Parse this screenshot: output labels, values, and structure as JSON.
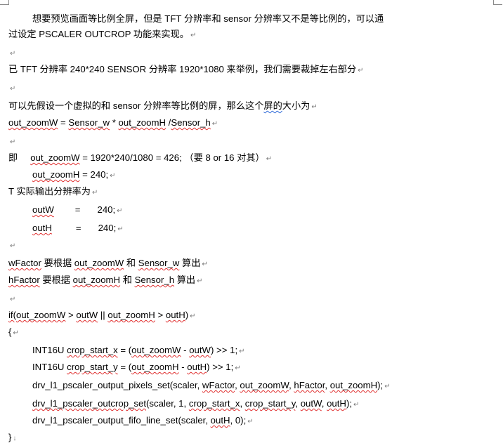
{
  "para_mark": "↵",
  "end_mark": "↓",
  "lines": {
    "l1": "想要预览画面等比例全屏，但是 TFT 分辨率和 sensor 分辨率又不是等比例的，可以通",
    "l2": "过设定 PSCALER OUTCROP 功能来实现。",
    "l4": "已 TFT 分辨率 240*240 SENSOR 分辨率 1920*1080 来举例，我们需要裁掉左右部分",
    "l6a": "可以先假设一个虚拟的和 sensor 分辨率等比例的屏，那么这个",
    "l6b": "屏的",
    "l6c": "大小为",
    "l7a": "out_zoomW",
    "l7b": " = ",
    "l7c": "Sensor_w",
    "l7d": " * ",
    "l7e": "out_zoomH",
    "l7f": " /",
    "l7g": "Sensor_h",
    "l9a": "即",
    "l9b": "out_zoomW",
    "l9c": " = 1920*240/1080 = 426; （要 8 or 16 对其）",
    "l10a": "out_zoomH",
    "l10b": " = 240;",
    "l11": "T 实际输出分辨率为",
    "l12a": "outW",
    "l12b": "=",
    "l12c": "240;",
    "l13a": "outH",
    "l13b": "=",
    "l13c": "240;",
    "l15a": "wFactor",
    "l15b": " 要根据 ",
    "l15c": "out_zoomW",
    "l15d": " 和 ",
    "l15e": "Sensor_w",
    "l15f": " 算出",
    "l16a": "hFactor",
    "l16b": " 要根据 ",
    "l16c": "out_zoomH",
    "l16d": " 和 ",
    "l16e": "Sensor_h",
    "l16f": " 算出",
    "l18a": "if(",
    "l18b": "out_zoomW",
    "l18c": " > ",
    "l18d": "outW",
    "l18e": " || ",
    "l18f": "out_zoomH",
    "l18g": " > ",
    "l18h": "outH",
    "l18i": ")",
    "l19": "{",
    "l20a": "INT16U ",
    "l20b": "crop_start_x",
    "l20c": " = (",
    "l20d": "out_zoomW",
    "l20e": " - ",
    "l20f": "outW",
    "l20g": ") >> 1;",
    "l21a": "INT16U ",
    "l21b": "crop_start_y",
    "l21c": " = (",
    "l21d": "out_zoomH",
    "l21e": " - ",
    "l21f": "outH",
    "l21g": ") >> 1;",
    "l22a": "drv_l1_pscaler_output_pixels_set(scaler, ",
    "l22b": "wFactor",
    "l22c": ", ",
    "l22d": "out_zoomW",
    "l22e": ", ",
    "l22f": "hFactor",
    "l22g": ", ",
    "l22h": "out_zoomH",
    "l22i": ");",
    "l23a": "drv_l1_pscaler_outcrop_set",
    "l23b": "(scaler, 1, ",
    "l23c": "crop_start_x",
    "l23d": ", ",
    "l23e": "crop_start_y",
    "l23f": ", ",
    "l23g": "outW",
    "l23h": ", ",
    "l23i": "outH",
    "l23j": ");",
    "l24a": "drv_l1_pscaler_output_fifo_line_set(scaler, ",
    "l24b": "outH",
    "l24c": ", 0);",
    "l25": "}"
  }
}
